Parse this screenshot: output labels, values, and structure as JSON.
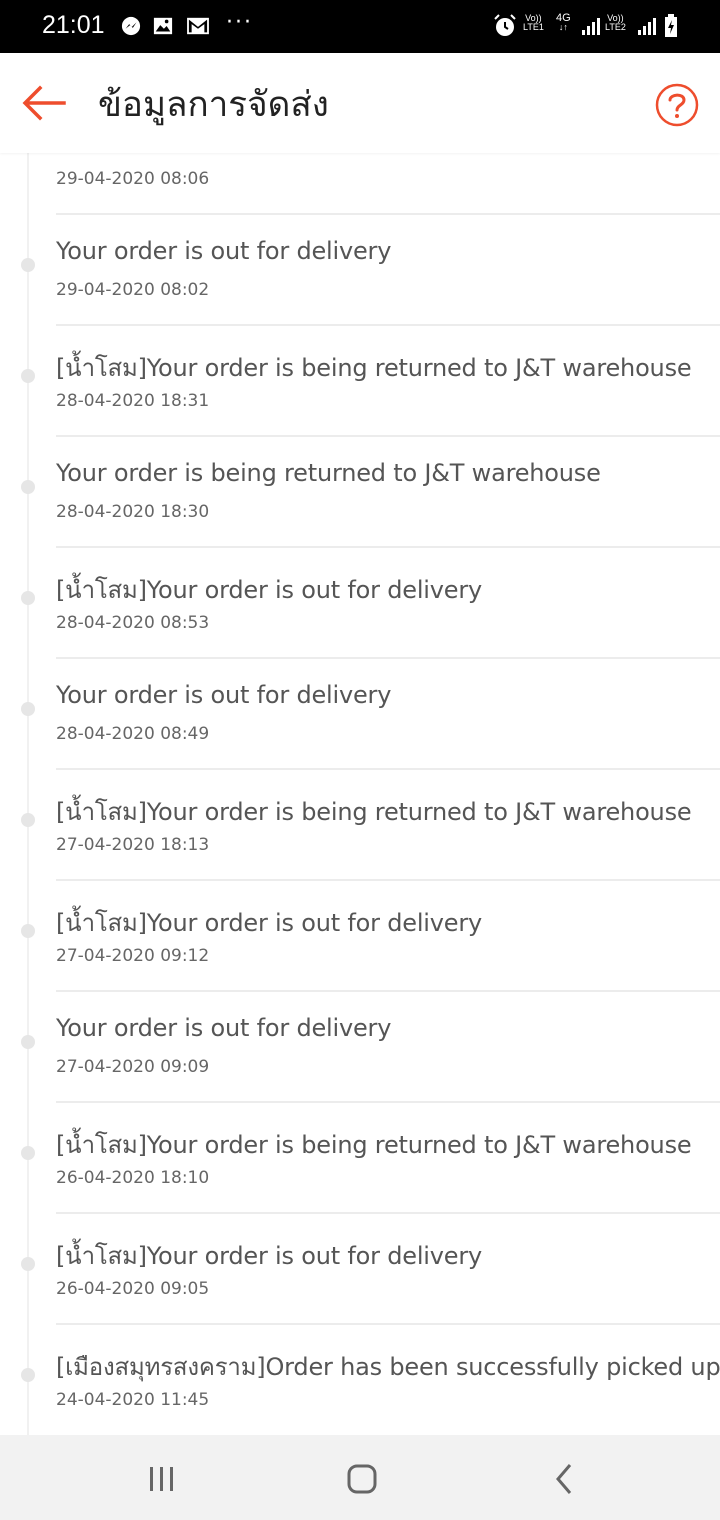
{
  "status_bar": {
    "time": "21:01",
    "icons": [
      "messenger-icon",
      "gallery-icon",
      "gmail-icon",
      "more-dots-icon",
      "alarm-icon",
      "volte-icon",
      "4g-icon",
      "signal-icon",
      "battery-icon"
    ],
    "lte1_top": "Vo))",
    "lte1_bottom": "LTE1",
    "net": "4G",
    "lte2_top": "Vo))",
    "lte2_bottom": "LTE2",
    "more": "···"
  },
  "header": {
    "title": "ข้อมูลการจัดส่ง",
    "accent_color": "#ee4d2d"
  },
  "partial_top_item": {
    "time": "29-04-2020 08:06"
  },
  "items": [
    {
      "message": "Your order is out for delivery",
      "time": "29-04-2020 08:02"
    },
    {
      "message": "[น้ำโสม]Your order is being returned to J&T warehouse",
      "time": "28-04-2020 18:31"
    },
    {
      "message": "Your order is being returned to J&T warehouse",
      "time": "28-04-2020 18:30"
    },
    {
      "message": "[น้ำโสม]Your order is out for delivery",
      "time": "28-04-2020 08:53"
    },
    {
      "message": "Your order is out for delivery",
      "time": "28-04-2020 08:49"
    },
    {
      "message": "[น้ำโสม]Your order is being returned to J&T warehouse",
      "time": "27-04-2020 18:13"
    },
    {
      "message": "[น้ำโสม]Your order is out for delivery",
      "time": "27-04-2020 09:12"
    },
    {
      "message": "Your order is out for delivery",
      "time": "27-04-2020 09:09"
    },
    {
      "message": "[น้ำโสม]Your order is being returned to J&T warehouse",
      "time": "26-04-2020 18:10"
    },
    {
      "message": "[น้ำโสม]Your order is out for delivery",
      "time": "26-04-2020 09:05"
    },
    {
      "message": "[เมืองสมุทรสงคราม]Order has been successfully picked up",
      "time": "24-04-2020 11:45"
    }
  ],
  "nav": {
    "icons": [
      "recent-apps-icon",
      "home-icon",
      "back-icon"
    ]
  }
}
